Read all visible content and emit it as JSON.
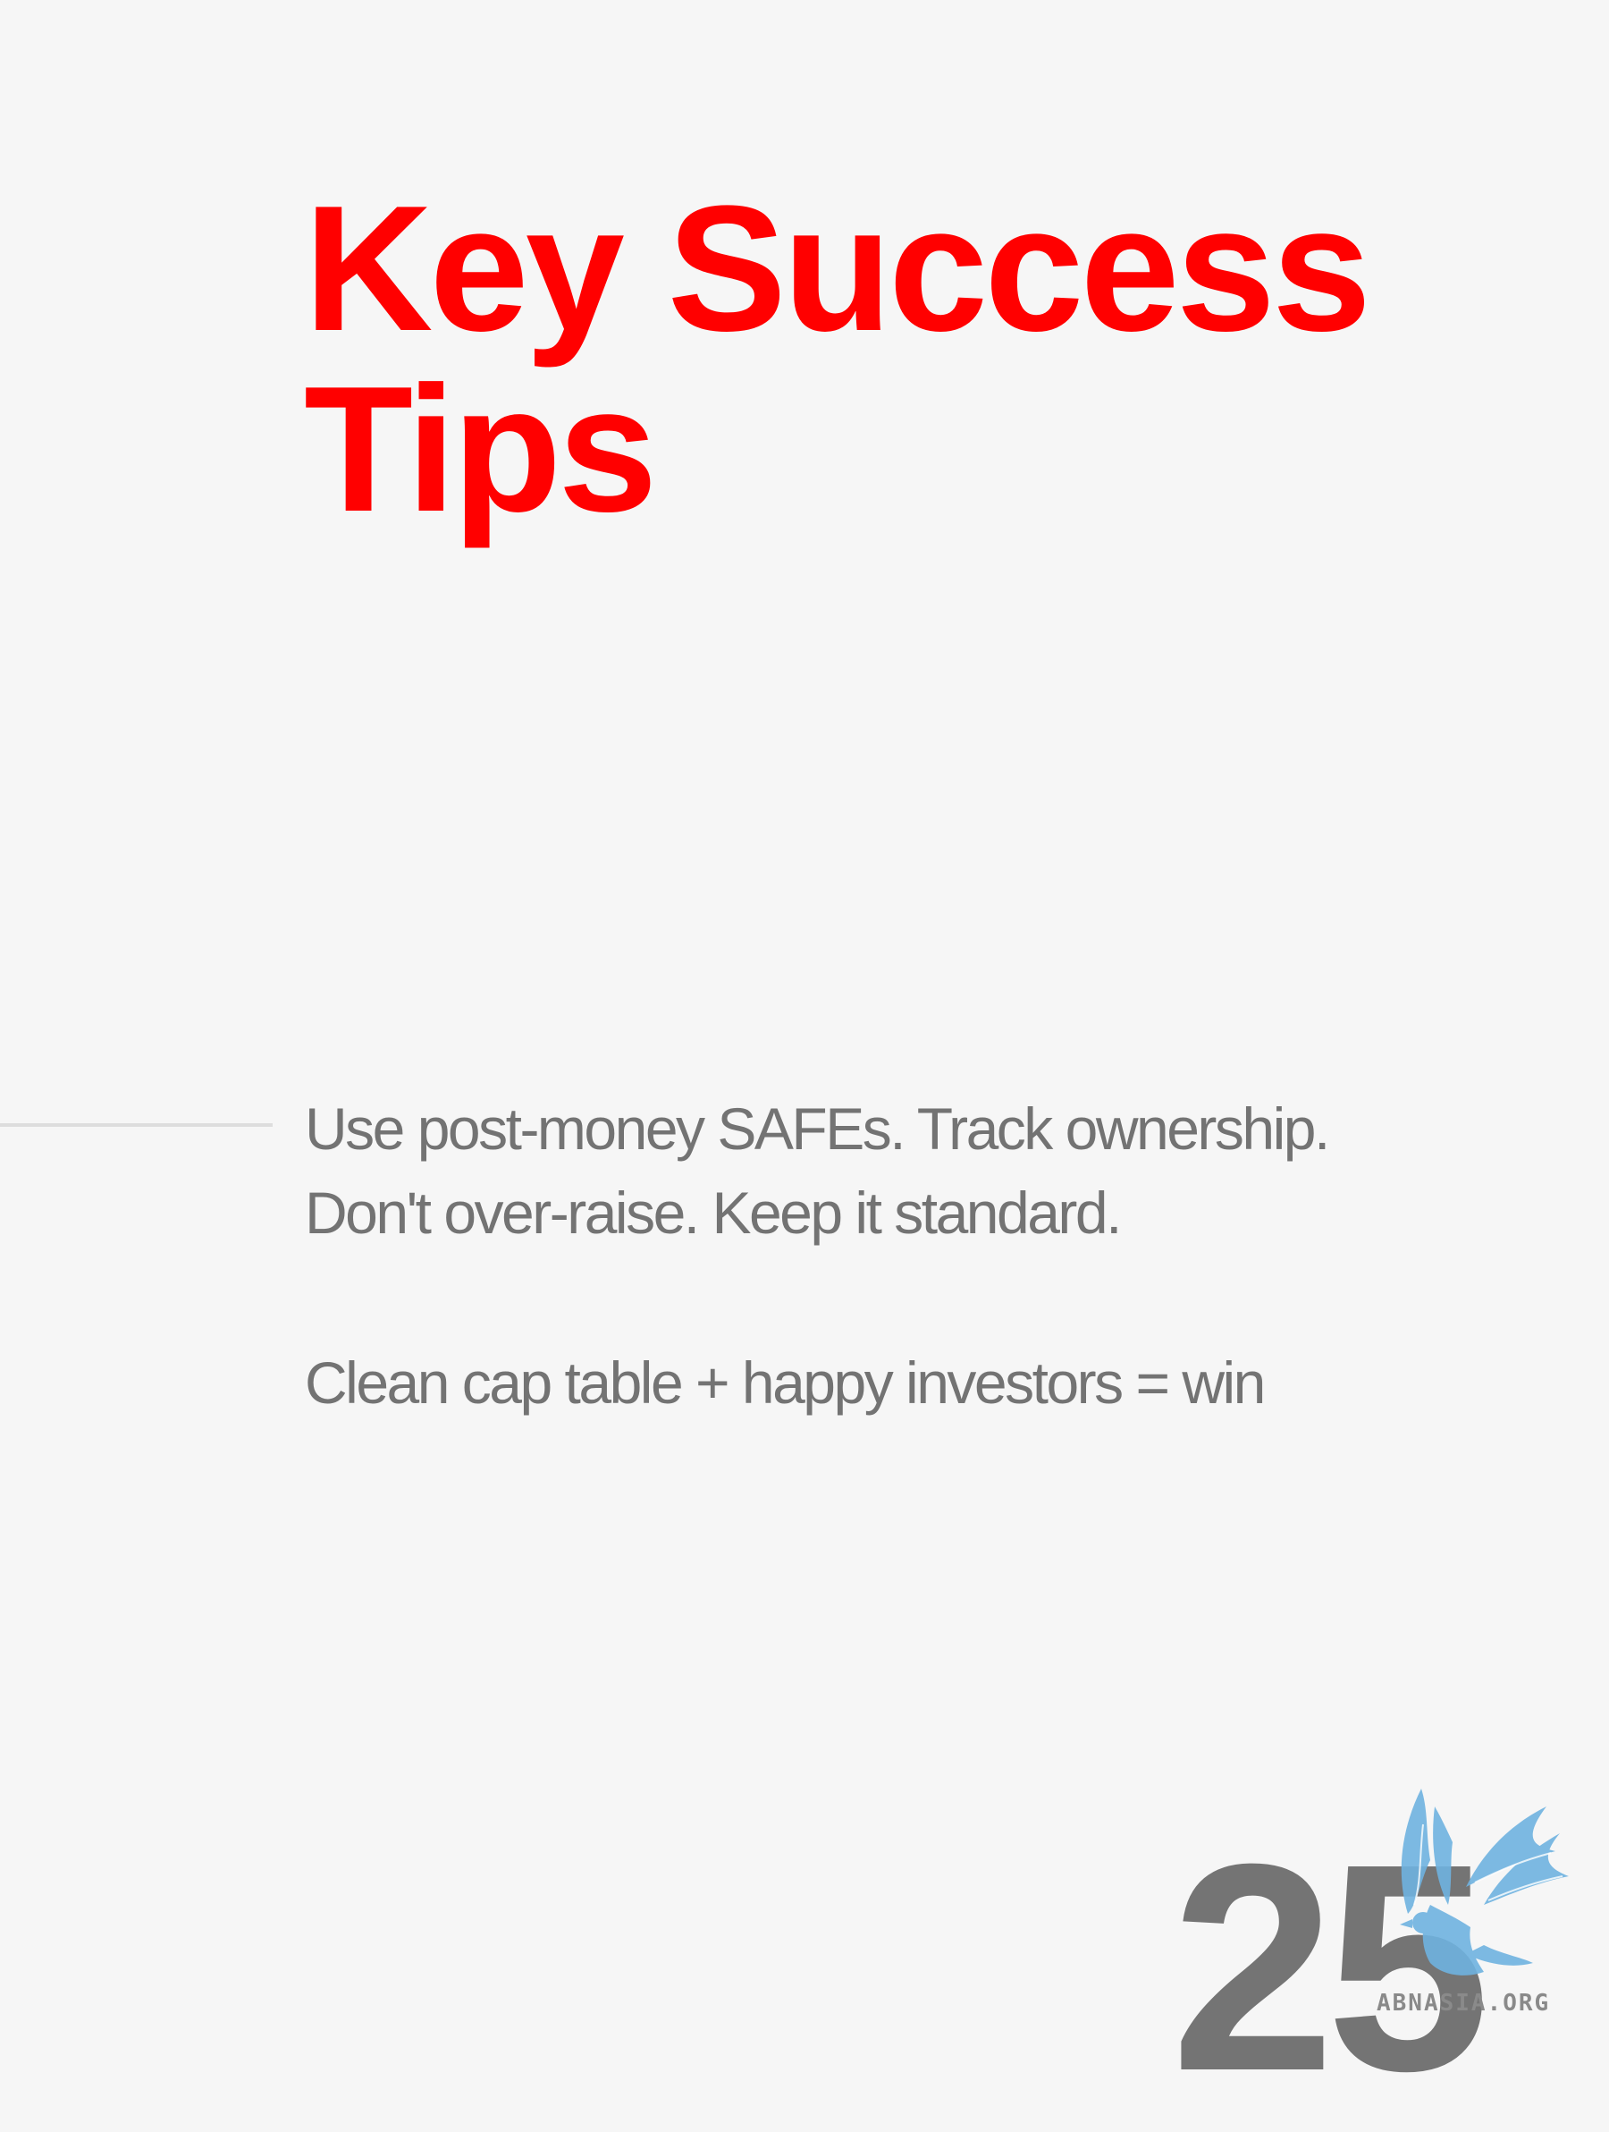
{
  "slide": {
    "title_lines": [
      "Key Success",
      "Tips"
    ],
    "body_lines": [
      "Use post-money SAFEs. Track ownership.",
      "Don't over-raise. Keep it standard."
    ],
    "summary": "Clean cap table + happy investors = win",
    "page_number": "25"
  },
  "watermark": {
    "text": "ABNASIA.ORG",
    "icon": "griffin-logo-icon"
  },
  "colors": {
    "background": "#f6f6f6",
    "title": "#ff0000",
    "body_text": "#737373",
    "divider": "#dddddd",
    "page_number": "#747474",
    "logo": "#6fb3e0"
  }
}
